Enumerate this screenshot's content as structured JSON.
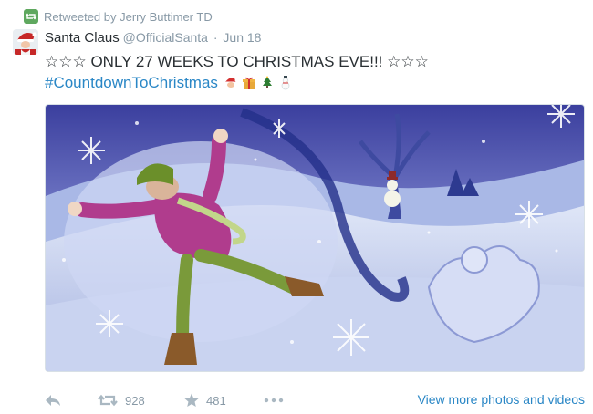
{
  "retweet_context": {
    "text": "Retweeted by Jerry Buttimer TD",
    "icon": "retweet-icon",
    "color": "#5fa85f"
  },
  "author": {
    "fullname": "Santa Claus",
    "username": "@OfficialSanta",
    "separator": "·",
    "time": "Jun 18"
  },
  "tweet": {
    "text": "☆☆☆ ONLY 27 WEEKS TO CHRISTMAS EVE!!! ☆☆☆",
    "hashtag": "#CountdownToChristmas",
    "emoji_icons": [
      "santa-face-icon",
      "gift-icon",
      "christmas-tree-icon",
      "snowman-icon"
    ]
  },
  "actions": {
    "reply_icon": "reply-icon",
    "retweet_icon": "retweet-icon",
    "retweet_count": "928",
    "favorite_icon": "star-icon",
    "favorite_count": "481",
    "more_icon": "more-dots-icon",
    "view_more": "View more photos and videos"
  },
  "colors": {
    "link": "#2a87c6",
    "muted": "#8899a6",
    "text": "#292f33"
  }
}
